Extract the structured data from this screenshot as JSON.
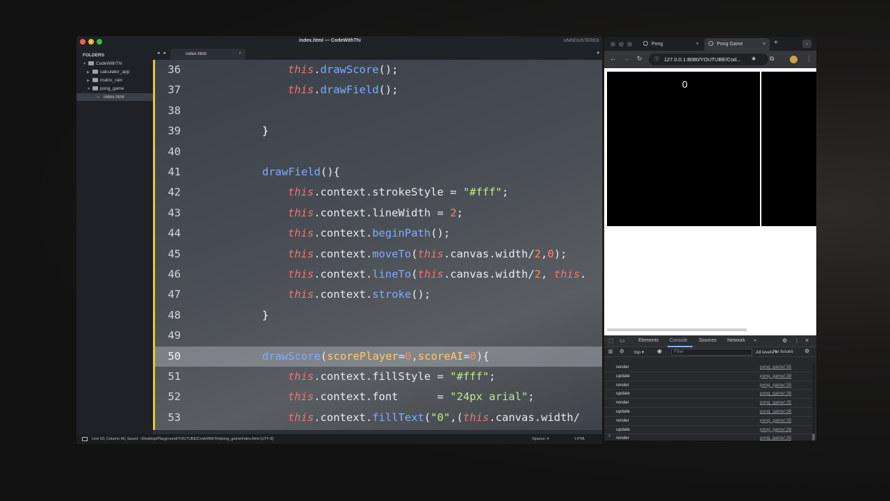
{
  "editor": {
    "window_title": "index.html — CodeWithThi",
    "unregistered": "UNREGISTERED",
    "sidebar": {
      "header": "FOLDERS",
      "items": [
        {
          "label": "CodeWithThi"
        },
        {
          "label": "calculator_app"
        },
        {
          "label": "matrix_rain"
        },
        {
          "label": "pong_game"
        },
        {
          "label": "index.html"
        }
      ]
    },
    "tab": {
      "label": "index.html",
      "nav": "◂ ▸",
      "close": "×",
      "dropdown": "▾"
    },
    "line_numbers": [
      "36",
      "37",
      "38",
      "39",
      "40",
      "41",
      "42",
      "43",
      "44",
      "45",
      "46",
      "47",
      "48",
      "49",
      "50",
      "51",
      "52",
      "53"
    ],
    "highlighted_line": "50",
    "status": {
      "left": "Line 50, Column 46; Saved ~/Desktop/Playground/YOUTUBE/CodeWithThi/pong_game/index.html (UTF-8)",
      "spaces": "Spaces: 4",
      "syntax": "HTML"
    },
    "colors": {
      "accent_gutter": "#e9c53d",
      "keyword": "#f07178",
      "function": "#82aaff",
      "string": "#c3e88d",
      "number": "#f78c6c"
    }
  },
  "browser": {
    "tabs": [
      {
        "label": "Pong",
        "close": "×"
      },
      {
        "label": "Pong Game",
        "close": "×"
      }
    ],
    "new_tab": "+",
    "menu": "⌄",
    "url": "127.0.0.1:8080/YOUTUBE/Cod...",
    "url_info_icon": "ⓘ",
    "toolbar_icons": {
      "back": "←",
      "forward": "→",
      "reload": "↻",
      "star": "★",
      "extensions": "⧉",
      "more": "⋮"
    },
    "game": {
      "score": "0"
    },
    "devtools": {
      "tabs": [
        "Elements",
        "Console",
        "Sources",
        "Network",
        "»"
      ],
      "active_tab": "Console",
      "context": "top ▾",
      "filter_placeholder": "Filter",
      "levels": "All levels ▾",
      "issues": "No Issues",
      "logs": [
        {
          "msg": "render",
          "src": "pong_game/:35"
        },
        {
          "msg": "update",
          "src": "pong_game/:38"
        },
        {
          "msg": "render",
          "src": "pong_game/:35"
        },
        {
          "msg": "update",
          "src": "pong_game/:38"
        },
        {
          "msg": "render",
          "src": "pong_game/:35"
        },
        {
          "msg": "update",
          "src": "pong_game/:38"
        },
        {
          "msg": "render",
          "src": "pong_game/:35"
        },
        {
          "msg": "update",
          "src": "pong_game/:38"
        },
        {
          "msg": "render",
          "src": "pong_game/:35"
        },
        {
          "msg": "update",
          "src": "pong_game/:38"
        },
        {
          "msg": "render",
          "src": "pong_game/:35"
        }
      ],
      "prompt": "›"
    }
  }
}
